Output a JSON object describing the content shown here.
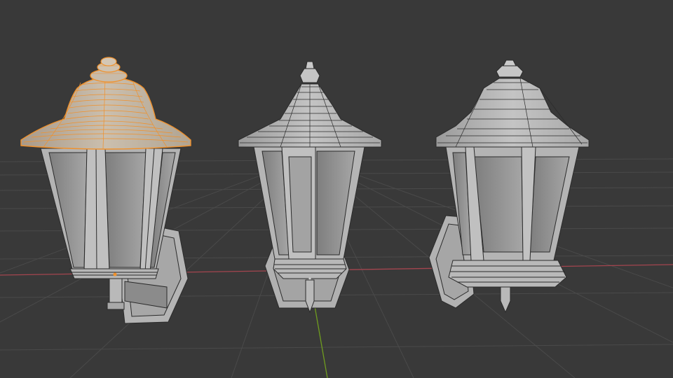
{
  "viewport": {
    "background": "#393939",
    "grid_color": "#4a4a4a",
    "x_axis_color": "#a4454f",
    "y_axis_color": "#6f9c1f"
  },
  "scene": {
    "objects": [
      {
        "id": "lamp-1",
        "variant": "rounded-cap",
        "selected": true
      },
      {
        "id": "lamp-2",
        "variant": "hexagonal",
        "selected": false
      },
      {
        "id": "lamp-3",
        "variant": "hexagonal-wide",
        "selected": false
      }
    ],
    "mesh_color": "#b9b9b9",
    "pane_color": "#8e8e8e",
    "wire_color": "#2b2b2b",
    "selection_color": "#f0912c"
  }
}
